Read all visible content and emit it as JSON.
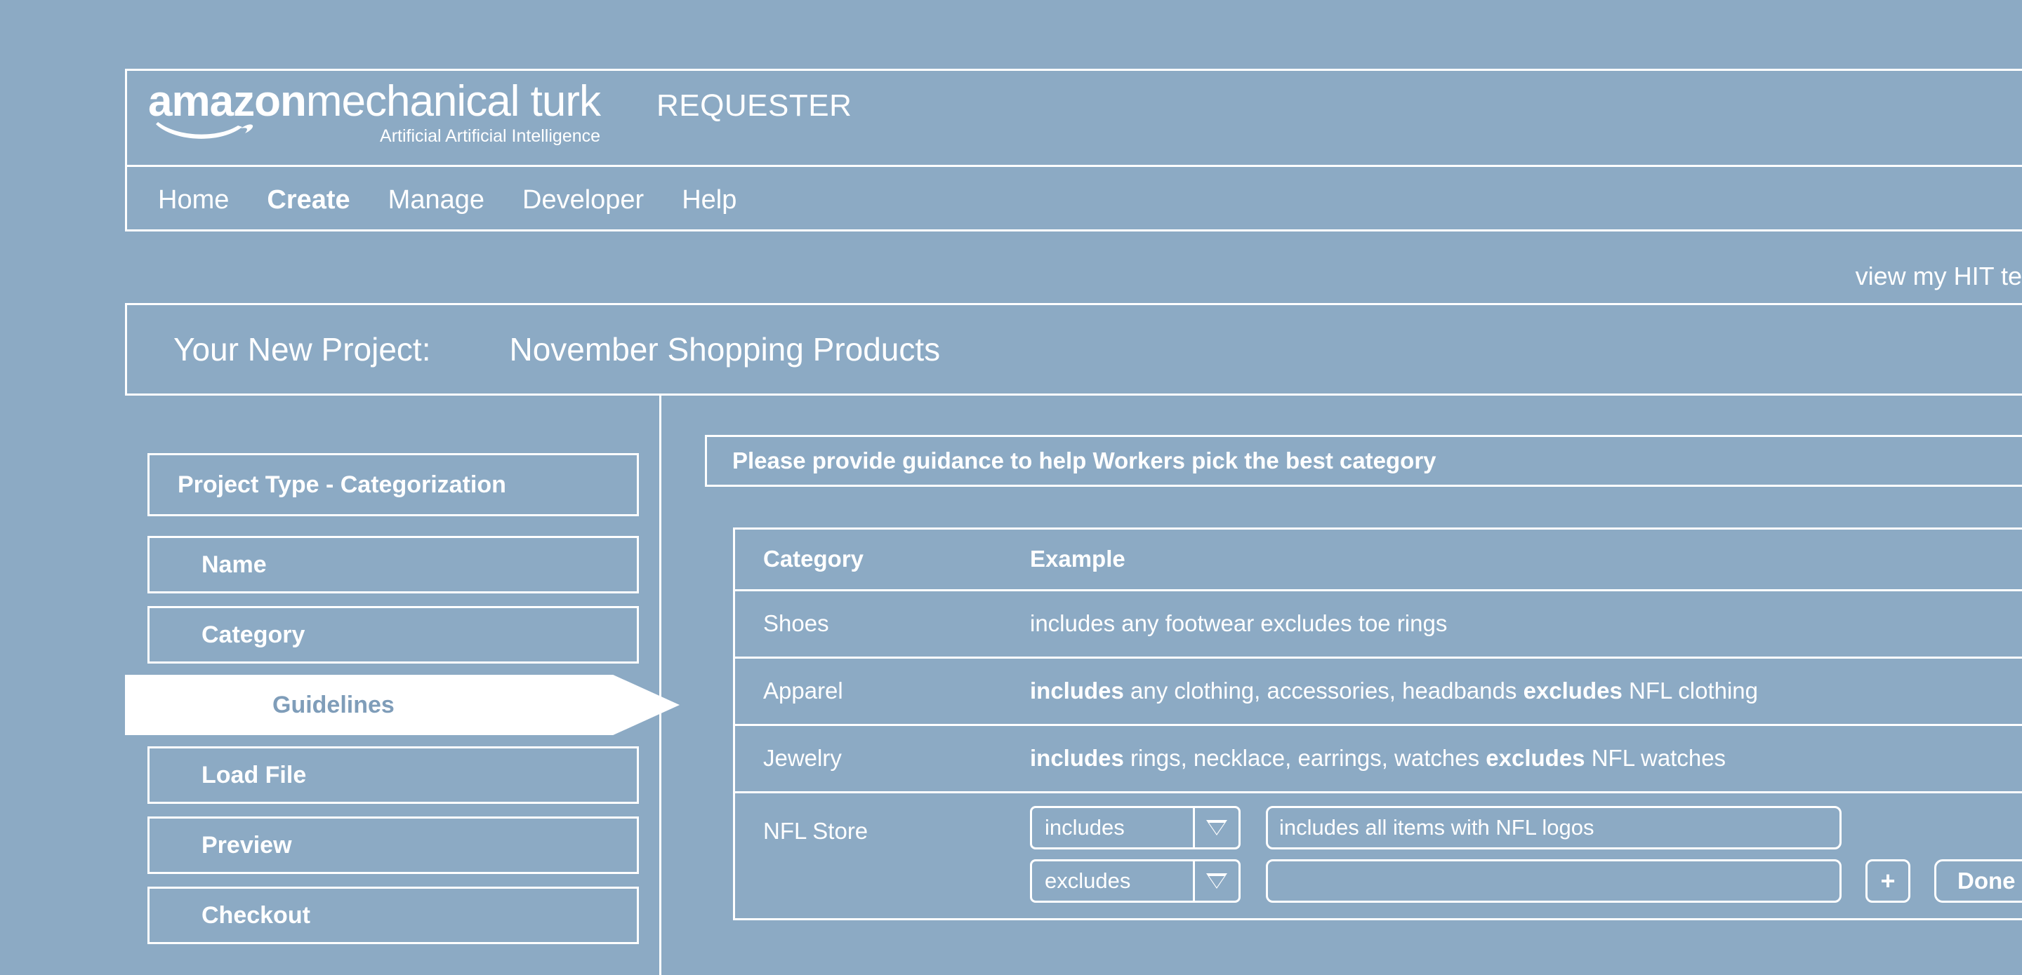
{
  "colors": {
    "background": "#8caac4",
    "foreground": "#ffffff",
    "active_step_text": "#7f9db9",
    "active_step_background": "#ffffff"
  },
  "header": {
    "logo_amazon": "amazon",
    "logo_product": "mechanical turk",
    "logo_tagline": "Artificial Artificial Intelligence",
    "logo_swoosh_icon": "amazon-smile-swoosh",
    "role_label": "REQUESTER"
  },
  "nav": {
    "items": [
      {
        "label": "Home",
        "active": false
      },
      {
        "label": "Create",
        "active": true
      },
      {
        "label": "Manage",
        "active": false
      },
      {
        "label": "Developer",
        "active": false
      },
      {
        "label": "Help",
        "active": false
      }
    ]
  },
  "utility": {
    "hit_templates_link": "view my HIT te"
  },
  "project": {
    "label": "Your New Project:",
    "name": "November Shopping Products"
  },
  "sidebar": {
    "steps": [
      {
        "label": "Project Type - Categorization",
        "active": false
      },
      {
        "label": "Name",
        "active": false
      },
      {
        "label": "Category",
        "active": false
      },
      {
        "label": "Guidelines",
        "active": true
      },
      {
        "label": "Load File",
        "active": false
      },
      {
        "label": "Preview",
        "active": false
      },
      {
        "label": "Checkout",
        "active": false
      }
    ]
  },
  "main": {
    "panel_title": "Please provide guidance to help Workers pick the best category",
    "table": {
      "columns": [
        "Category",
        "Example"
      ],
      "rows": [
        {
          "category": "Shoes",
          "example_prefix": "includes",
          "example_middle": " any footwear ",
          "example_keyword2": "excludes",
          "example_suffix": " toe rings",
          "bold_keywords": false
        },
        {
          "category": "Apparel",
          "example_prefix": "includes",
          "example_middle": " any clothing, accessories, headbands ",
          "example_keyword2": "excludes",
          "example_suffix": " NFL clothing",
          "bold_keywords": true
        },
        {
          "category": "Jewelry",
          "example_prefix": "includes",
          "example_middle": " rings, necklace, earrings, watches ",
          "example_keyword2": "excludes",
          "example_suffix": " NFL watches",
          "bold_keywords": true
        }
      ],
      "edit_row": {
        "category": "NFL Store",
        "line1": {
          "select_value": "includes",
          "select_options": [
            "includes",
            "excludes"
          ],
          "input_value": "includes all items with NFL logos",
          "input_placeholder": ""
        },
        "line2": {
          "select_value": "excludes",
          "select_options": [
            "includes",
            "excludes"
          ],
          "input_value": "",
          "input_placeholder": ""
        },
        "add_button_label": "+",
        "done_button_label": "Done"
      }
    }
  }
}
